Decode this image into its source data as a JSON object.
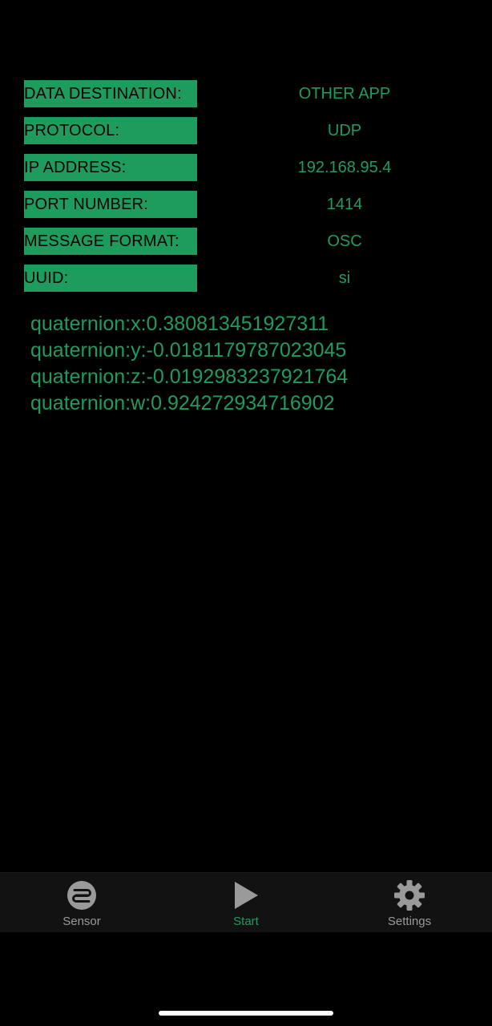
{
  "colors": {
    "accent": "#1e9c5e",
    "background": "#000000",
    "tabbar_background": "#121212",
    "tab_inactive": "#9a9a9a"
  },
  "settings": {
    "rows": [
      {
        "label": "DATA DESTINATION:",
        "value": "OTHER APP"
      },
      {
        "label": "PROTOCOL:",
        "value": "UDP"
      },
      {
        "label": "IP ADDRESS:",
        "value": "192.168.95.4"
      },
      {
        "label": "PORT NUMBER:",
        "value": "1414"
      },
      {
        "label": "MESSAGE FORMAT:",
        "value": "OSC"
      },
      {
        "label": "UUID:",
        "value": "si"
      }
    ]
  },
  "readout": {
    "lines": [
      "quaternion:x:0.380813451927311",
      "quaternion:y:-0.0181179787023045",
      "quaternion:z:-0.0192983237921764",
      "quaternion:w:0.924272934716902"
    ]
  },
  "tabbar": {
    "tabs": [
      {
        "label": "Sensor",
        "icon": "sensor-icon",
        "active": false
      },
      {
        "label": "Start",
        "icon": "play-icon",
        "active": true
      },
      {
        "label": "Settings",
        "icon": "gear-icon",
        "active": false
      }
    ]
  }
}
